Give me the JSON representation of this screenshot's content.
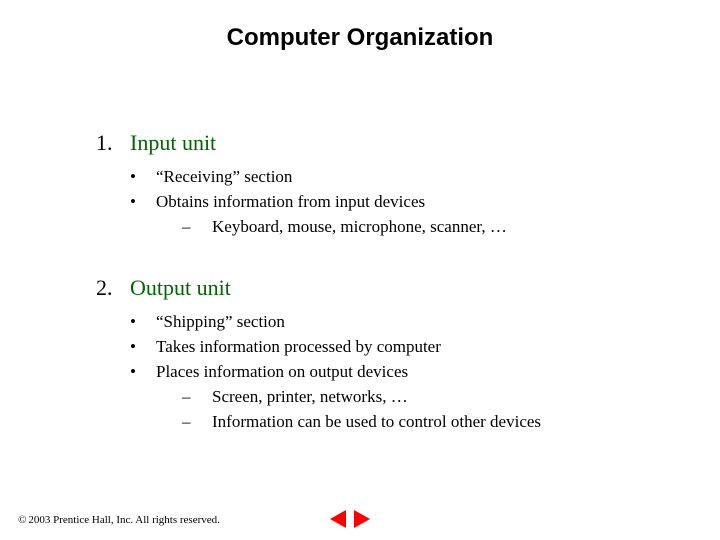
{
  "title": "Computer Organization",
  "items": [
    {
      "heading": "Input unit",
      "bullets": [
        {
          "text": "“Receiving” section"
        },
        {
          "text": "Obtains information from input devices",
          "sub": [
            "Keyboard, mouse, microphone, scanner, …"
          ]
        }
      ]
    },
    {
      "heading": "Output unit",
      "bullets": [
        {
          "text": "“Shipping” section"
        },
        {
          "text": "Takes information processed by computer"
        },
        {
          "text": "Places information on output devices",
          "sub": [
            "Screen, printer, networks, …",
            "Information can be used to control other devices"
          ]
        }
      ]
    }
  ],
  "footer": {
    "copyright_symbol": "©",
    "text": " 2003 Prentice Hall, Inc. All rights reserved."
  }
}
